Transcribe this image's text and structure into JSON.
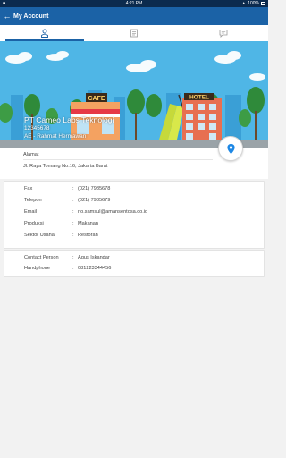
{
  "status": {
    "time": "4:21 PM",
    "battery": "100%"
  },
  "appbar": {
    "title": "My Account"
  },
  "tabs": [
    {
      "name": "profile",
      "icon": "person-icon",
      "active": true
    },
    {
      "name": "document",
      "icon": "document-icon",
      "active": false
    },
    {
      "name": "chat",
      "icon": "chat-icon",
      "active": false
    }
  ],
  "hero": {
    "company_name": "PT Cameo Labs Teknologi",
    "company_id": "12345678",
    "ae": "AE - Rahmat Hermawan",
    "sign_cafe": "CAFE",
    "sign_hotel": "HOTEL"
  },
  "address": {
    "label": "Alamat",
    "value": "Jl. Raya Tomang No.16, Jakarta Barat"
  },
  "details": [
    {
      "key": "Fax",
      "value": "(021) 7985678"
    },
    {
      "key": "Telepon",
      "value": "(021) 7985679"
    },
    {
      "key": "Email",
      "value": "rio.samsul@amansentosa.co.id"
    },
    {
      "key": "Produksi",
      "value": "Makanan"
    },
    {
      "key": "Sektor Usaha",
      "value": "Restoran"
    }
  ],
  "contact": [
    {
      "key": "Contact Person",
      "value": "Agus Iskandar"
    },
    {
      "key": "Handphone",
      "value": "081223344456"
    }
  ],
  "separator": ":",
  "colors": {
    "appbar": "#1b62a6",
    "statusbar": "#0c2b4e",
    "sky": "#4fb6e6",
    "accent": "#1e88e5"
  }
}
